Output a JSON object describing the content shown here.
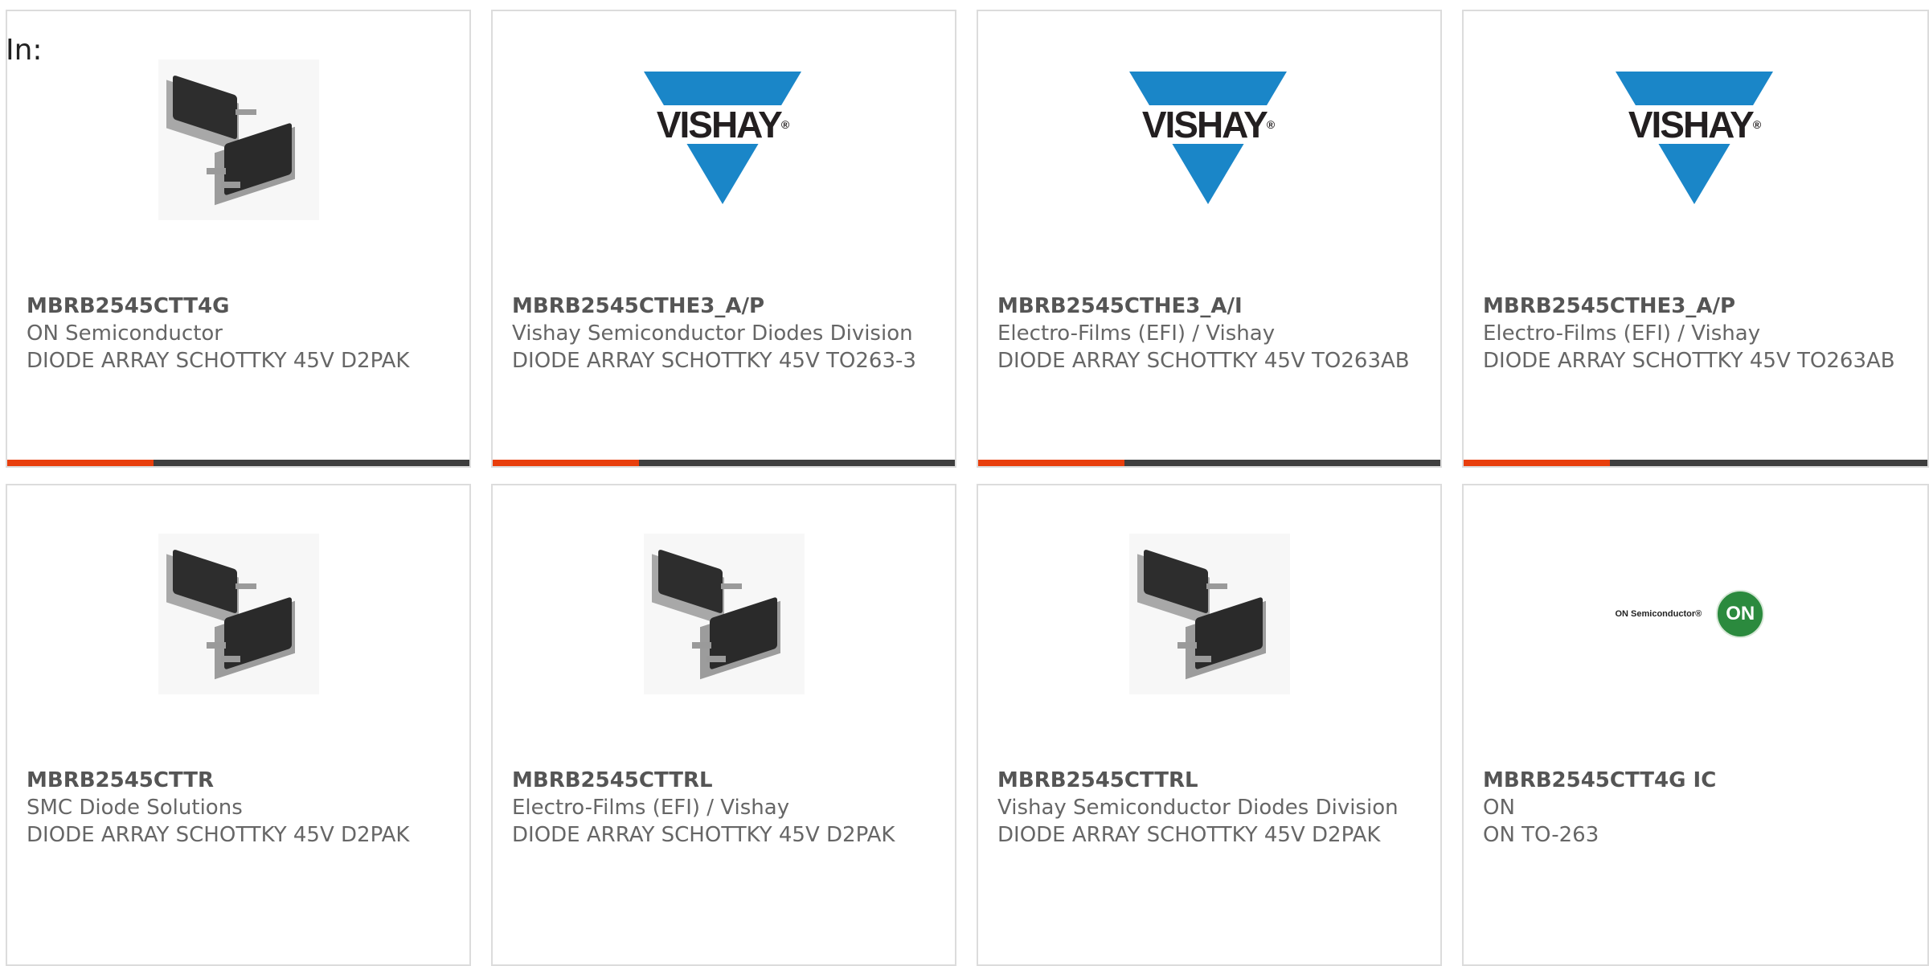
{
  "header": {
    "in_label": "In:"
  },
  "products": [
    {
      "part": "MBRB2545CTT4G",
      "manufacturer": "ON Semiconductor",
      "description": "DIODE ARRAY SCHOTTKY 45V D2PAK",
      "image": "d2pak-package"
    },
    {
      "part": "MBRB2545CTHE3_A/P",
      "manufacturer": "Vishay Semiconductor Diodes Division",
      "description": "DIODE ARRAY SCHOTTKY 45V TO263-3",
      "image": "vishay-logo"
    },
    {
      "part": "MBRB2545CTHE3_A/I",
      "manufacturer": "Electro-Films (EFI) / Vishay",
      "description": "DIODE ARRAY SCHOTTKY 45V TO263AB",
      "image": "vishay-logo"
    },
    {
      "part": "MBRB2545CTHE3_A/P",
      "manufacturer": "Electro-Films (EFI) / Vishay",
      "description": "DIODE ARRAY SCHOTTKY 45V TO263AB",
      "image": "vishay-logo"
    },
    {
      "part": "MBRB2545CTTR",
      "manufacturer": "SMC Diode Solutions",
      "description": "DIODE ARRAY SCHOTTKY 45V D2PAK",
      "image": "d2pak-package"
    },
    {
      "part": "MBRB2545CTTRL",
      "manufacturer": "Electro-Films (EFI) / Vishay",
      "description": "DIODE ARRAY SCHOTTKY 45V D2PAK",
      "image": "d2pak-package"
    },
    {
      "part": "MBRB2545CTTRL",
      "manufacturer": "Vishay Semiconductor Diodes Division",
      "description": "DIODE ARRAY SCHOTTKY 45V D2PAK",
      "image": "d2pak-package"
    },
    {
      "part": "MBRB2545CTT4G IC",
      "manufacturer": "ON",
      "description": "ON TO-263",
      "image": "on-semiconductor-logo"
    }
  ],
  "logos": {
    "vishay_text": "VISHAY",
    "vishay_reg": "®",
    "on_text": "ON Semiconductor®",
    "on_badge": "ON"
  },
  "colors": {
    "accent": "#e83e0c",
    "bar": "#3e3e3e",
    "vishay_blue": "#1a86c8",
    "on_green": "#2b8a3e"
  }
}
